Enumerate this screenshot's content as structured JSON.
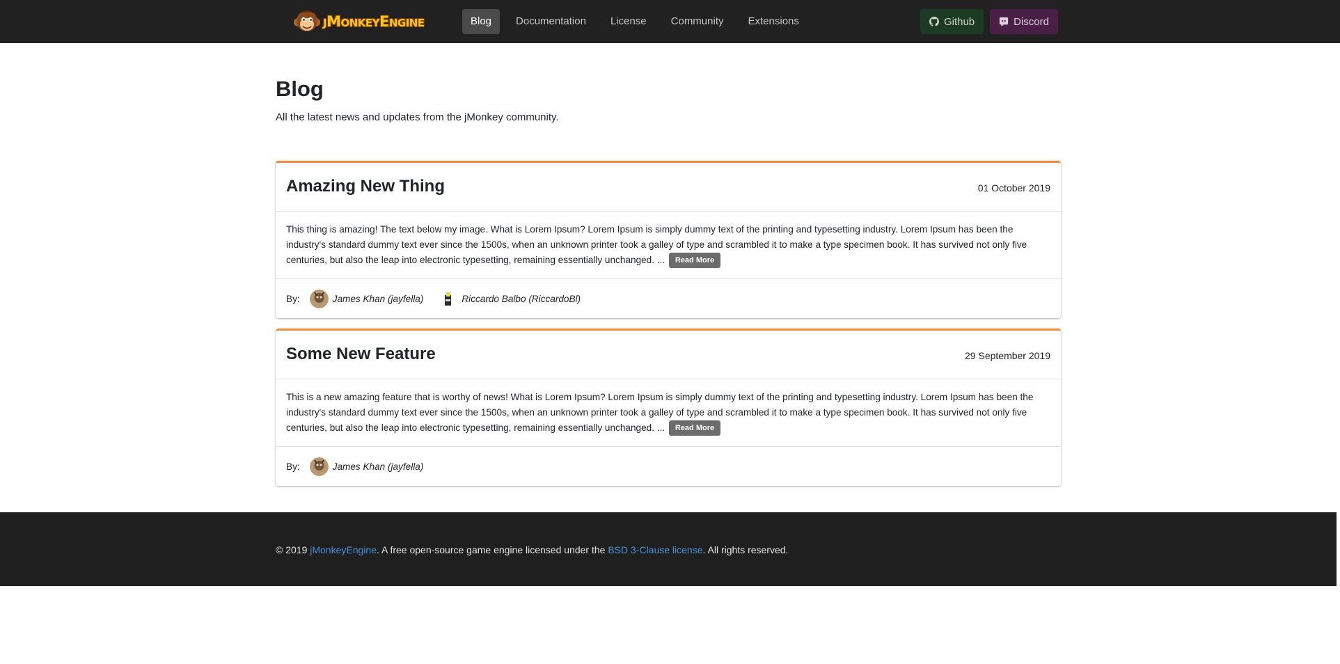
{
  "navbar": {
    "brand_text": "jMonkeyEngine",
    "logo_icon": "monkey-logo-icon",
    "links": [
      {
        "label": "Blog",
        "active": true
      },
      {
        "label": "Documentation",
        "active": false
      },
      {
        "label": "License",
        "active": false
      },
      {
        "label": "Community",
        "active": false
      },
      {
        "label": "Extensions",
        "active": false
      }
    ],
    "github_label": "Github",
    "discord_label": "Discord"
  },
  "page": {
    "title": "Blog",
    "subtitle": "All the latest news and updates from the jMonkey community."
  },
  "posts": [
    {
      "title": "Amazing New Thing",
      "date": "01 October 2019",
      "body": "This thing is amazing! The text below my image. What is Lorem Ipsum? Lorem Ipsum is simply dummy text of the printing and typesetting industry. Lorem Ipsum has been the industry's standard dummy text ever since the 1500s, when an unknown printer took a galley of type and scrambled it to make a type specimen book. It has survived not only five centuries, but also the leap into electronic typesetting, remaining essentially unchanged. ...",
      "read_more": "Read More",
      "by_label": "By:",
      "authors": [
        "James Khan (jayfella)",
        "Riccardo Balbo (RiccardoBl)"
      ]
    },
    {
      "title": "Some New Feature",
      "date": "29 September 2019",
      "body": "This is a new amazing feature that is worthy of news! What is Lorem Ipsum? Lorem Ipsum is simply dummy text of the printing and typesetting industry. Lorem Ipsum has been the industry's standard dummy text ever since the 1500s, when an unknown printer took a galley of type and scrambled it to make a type specimen book. It has survived not only five centuries, but also the leap into electronic typesetting, remaining essentially unchanged. ...",
      "read_more": "Read More",
      "by_label": "By:",
      "authors": [
        "James Khan (jayfella)"
      ]
    }
  ],
  "footer": {
    "copyright": "© 2019 ",
    "site_link": "jMonkeyEngine",
    "middle": ". A free open-source game engine licensed under the ",
    "license_link": "BSD 3-Clause license",
    "end": ". All rights reserved."
  },
  "colors": {
    "navbar_bg": "#212121",
    "card_accent": "#f08c42",
    "footer_bg": "#1f1f1f",
    "link": "#4a90d9",
    "github_btn": "#1d3b24",
    "discord_btn": "#4a1f47"
  }
}
